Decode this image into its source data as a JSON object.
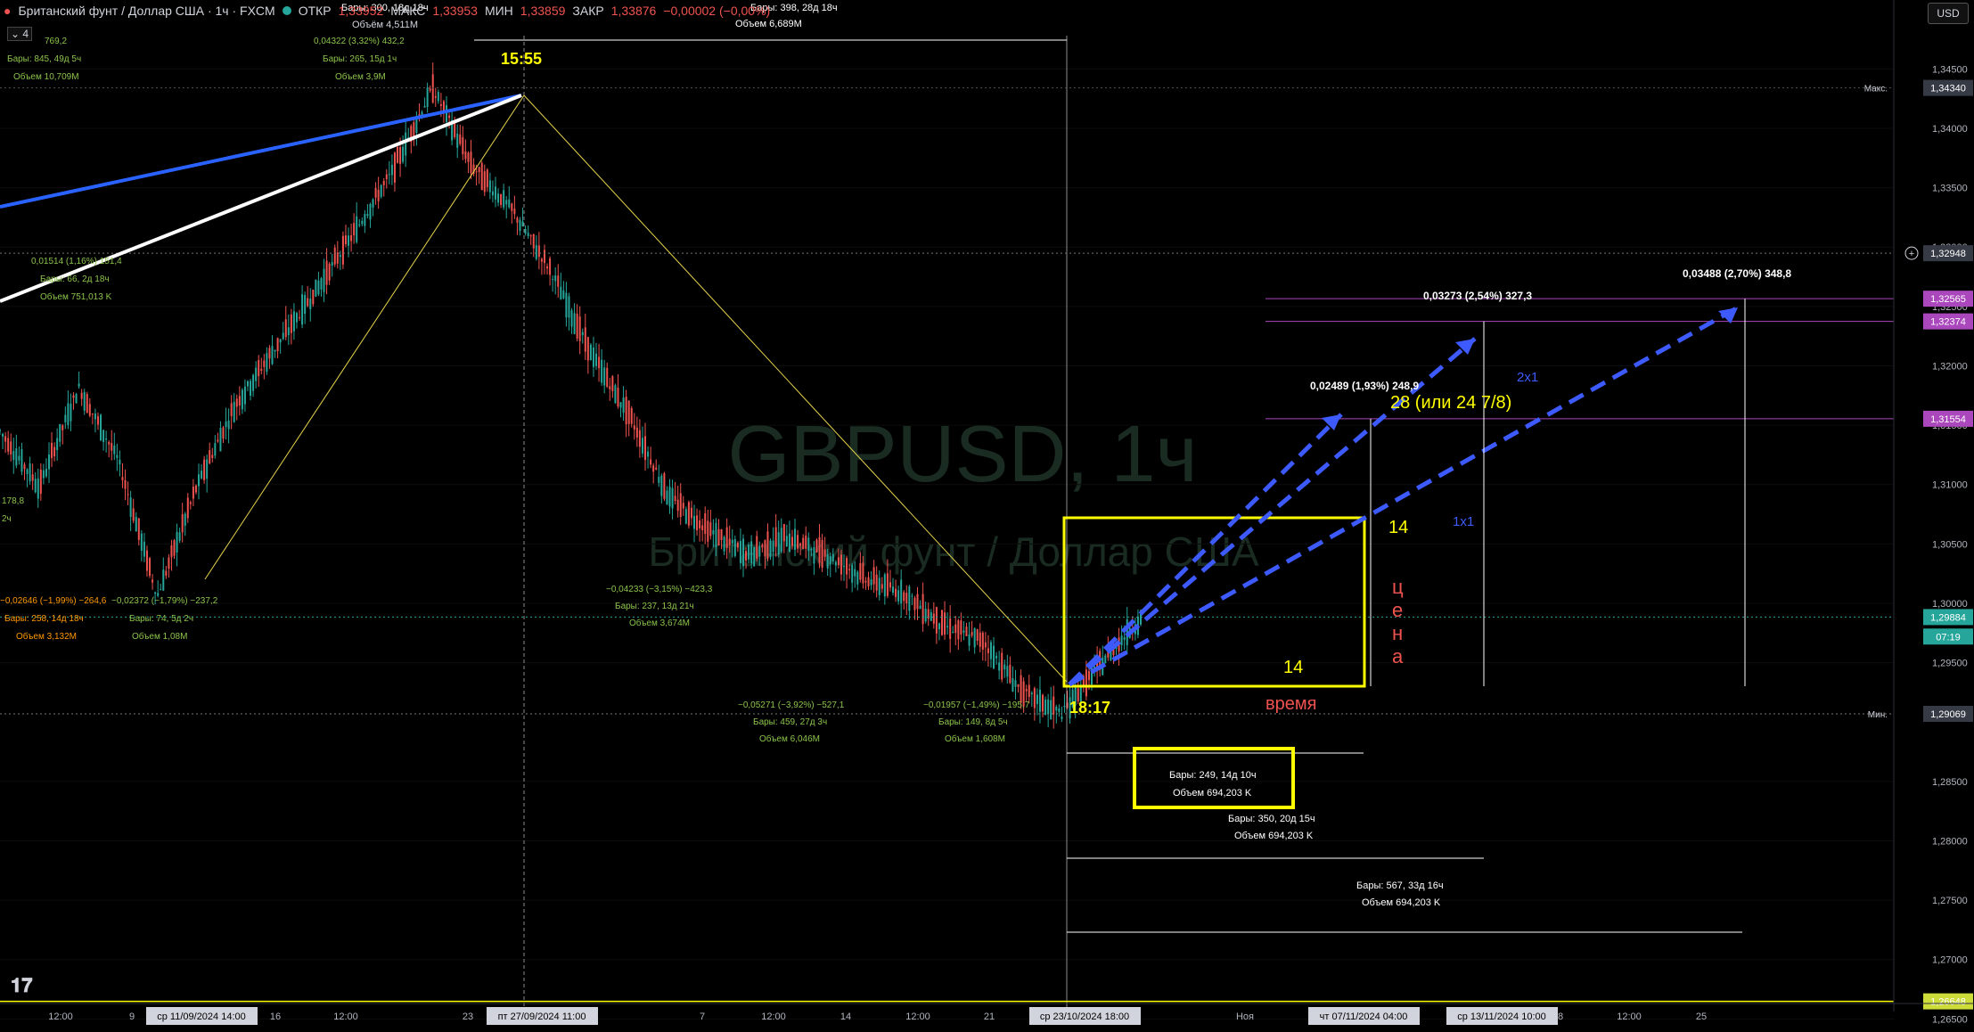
{
  "header": {
    "symbol_title": "Британский фунт / Доллар США · 1ч · FXCM",
    "open_label": "ОТКР",
    "open_value": "1,33952",
    "high_label": "МАКС",
    "high_value": "1,33953",
    "low_label": "МИН",
    "low_value": "1,33859",
    "close_label": "ЗАКР",
    "close_value": "1,33876",
    "change_value": "−0,00002 (−0,00%)",
    "volume_text": "Объём 4,511M",
    "collapse_label": "4"
  },
  "watermark": {
    "symbol": "GBPUSD, 1ч",
    "name": "Британский фунт / Доллар США"
  },
  "currency_button": "USD",
  "colors": {
    "background": "#000000",
    "up": "#26a69a",
    "down": "#ef5350",
    "yellow": "#ffff00",
    "blue_dashed": "#3d5afe",
    "violet": "#ab47bc"
  },
  "chart_data": {
    "type": "line",
    "title": "GBPUSD, 1ч",
    "ylim": [
      1.2645,
      1.3475
    ],
    "y_ticks": [
      "1,34500",
      "1,34000",
      "1,33500",
      "1,33000",
      "1,32500",
      "1,32000",
      "1,31500",
      "1,31000",
      "1,30500",
      "1,30000",
      "1,29500",
      "1,28500",
      "1,28000",
      "1,27500",
      "1,27000",
      "1,26500"
    ],
    "x_tick_labels": [
      "12:00",
      "9",
      "16",
      "12:00",
      "23",
      "7",
      "12:00",
      "14",
      "12:00",
      "21",
      "28",
      "Ноя",
      "18",
      "12:00",
      "25"
    ],
    "x_cursor_labels": [
      "ср 11/09/2024  14:00",
      "пт 27/09/2024  11:00",
      "ср 23/10/2024  18:00",
      "чт 07/11/2024  04:00",
      "ср 13/11/2024  10:00"
    ],
    "price_labels": [
      {
        "tag": "Макс.",
        "value": "1,34340"
      },
      {
        "tag": "",
        "value": "1,32948"
      },
      {
        "tag": "",
        "value": "1,32565"
      },
      {
        "tag": "",
        "value": "1,32374"
      },
      {
        "tag": "",
        "value": "1,31554"
      },
      {
        "tag": "",
        "value": "1,29884"
      },
      {
        "tag": "",
        "value": "07:19"
      },
      {
        "tag": "Мин.",
        "value": "1,29069"
      },
      {
        "tag": "",
        "value": "1,26648"
      }
    ],
    "series": [
      {
        "values": [
          1.3145,
          1.3098,
          1.3182,
          1.3121,
          1.3006,
          1.3098,
          1.3168,
          1.3215,
          1.3262,
          1.3312,
          1.3365,
          1.3434,
          1.3368,
          1.3332,
          1.328,
          1.3212,
          1.3158,
          1.309,
          1.3062,
          1.3041,
          1.3056,
          1.3041,
          1.3021,
          1.3008,
          1.2981,
          1.2968,
          1.2925,
          1.2907,
          1.295,
          1.2988
        ]
      }
    ],
    "annotations": {
      "top_time": "15:55",
      "low_time": "18:17",
      "price_label_vertical": "ц\nе\nн\nа",
      "time_label": "время",
      "box_side_count_right": "14",
      "box_side_count_bottom": "14",
      "ratio_2x1": "2x1",
      "ratio_1x1": "1x1",
      "text_28": "28 (или 24 7/8)",
      "target1": "0,02489 (1,93%) 248,9",
      "target2": "0,03273 (2,54%) 327,3",
      "target3": "0,03488 (2,70%) 348,8",
      "range1_bars": "Бары: 249, 14д 10ч",
      "range1_vol": "Объем 694,203 K",
      "range2_bars": "Бары: 350, 20д 15ч",
      "range2_vol": "Объем 694,203 K",
      "range3_bars": "Бары: 567, 33д 16ч",
      "range3_vol": "Объем 694,203 K",
      "m_a1": "0,04322 (3,32%) 432,2",
      "m_a2": "Бары: 265, 15д 1ч",
      "m_a3": "Объем 3,9M",
      "m_b1": "0,01514 (1,16%) 151,4",
      "m_b2": "Бары: 66, 2д 18ч",
      "m_b3": "Объем 751,013 K",
      "m_c1": "−0,02646 (−1,99%) −264,6",
      "m_c2": "Бары: 258, 14д 18ч",
      "m_c3": "Объем 3,132M",
      "m_d1": "−0,02372 (−1,79%) −237,2",
      "m_d2": "Бары: 74, 5д 2ч",
      "m_d3": "Объем 1,08M",
      "m_e1": "−0,04233 (−3,15%) −423,3",
      "m_e2": "Бары: 237, 13д 21ч",
      "m_e3": "Объем 3,674M",
      "m_f1": "−0,05271 (−3,92%) −527,1",
      "m_f2": "Бары: 459, 27д 3ч",
      "m_f3": "Объем 6,046M",
      "m_g1": "−0,01957 (−1,49%) −195,7",
      "m_g2": "Бары: 149, 8д 5ч",
      "m_g3": "Объем 1,608M",
      "m_h1": "Бары: 398, 28д 18ч",
      "m_h2": "Объем 6,689M",
      "m_i1": "Бары: 845, 49д 5ч",
      "m_i2": "Объем 10,709M",
      "m_j1": "Бары: 300, 18д 18ч",
      "m_k1": "769,2",
      "m_l1": "178,8",
      "m_l2": "2ч"
    }
  }
}
